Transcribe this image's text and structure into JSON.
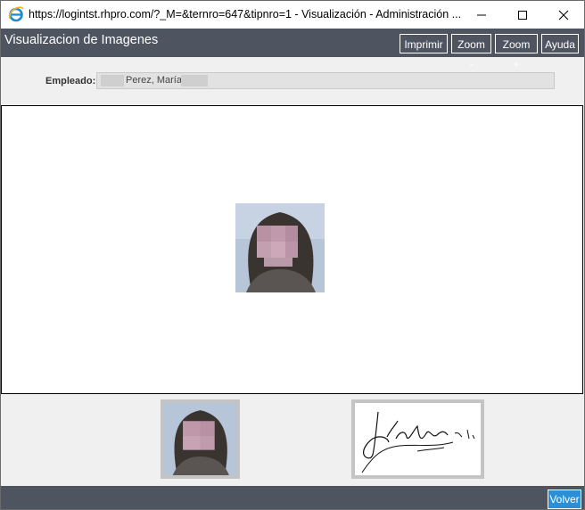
{
  "window": {
    "title": "https://logintst.rhpro.com/?_M=&ternro=647&tipnro=1 - Visualización - Administración ...",
    "icon": "internet-explorer-icon"
  },
  "header": {
    "title": "Visualizacion de Imagenes",
    "buttons": {
      "print": "Imprimir",
      "zoom_out": "Zoom -",
      "zoom_in": "Zoom +",
      "help": "Ayuda"
    },
    "background_color": "#4e5561"
  },
  "employee": {
    "label": "Empleado:",
    "value": "Perez, María"
  },
  "viewer": {
    "current_image": "employee-photo"
  },
  "thumbnails": [
    {
      "type": "photo",
      "name": "employee-photo-thumbnail"
    },
    {
      "type": "signature",
      "name": "employee-signature-thumbnail"
    }
  ],
  "footer": {
    "back_button": "Volver",
    "accent_color": "#2a8fd6"
  }
}
